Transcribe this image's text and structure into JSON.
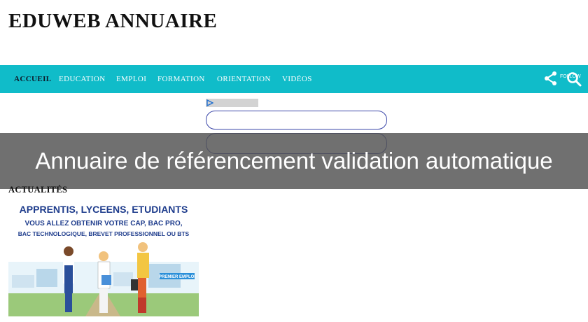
{
  "site": {
    "title": "EDUWEB ANNUAIRE"
  },
  "nav": {
    "items": [
      {
        "label": "ACCUEIL",
        "active": true
      },
      {
        "label": "EDUCATION",
        "active": false
      },
      {
        "label": "EMPLOI",
        "active": false
      },
      {
        "label": "FORMATION",
        "active": false
      },
      {
        "label": "ORIENTATION",
        "active": false
      },
      {
        "label": "VIDÉOS",
        "active": false
      }
    ],
    "follow_label": "FOLLOW",
    "accent_color": "#10bcc9"
  },
  "overlay": {
    "text": "Annuaire de référencement validation automatique"
  },
  "section": {
    "heading": "ACTUALITÉS"
  },
  "promo": {
    "line1": "APPRENTIS, LYCEENS, ETUDIANTS",
    "line2": "VOUS ALLEZ OBTENIR VOTRE CAP, BAC PRO,",
    "line3": "BAC TECHNOLOGIQUE, BREVET PROFESSIONNEL OU BTS",
    "badge": "PREMIER EMPLOI"
  }
}
